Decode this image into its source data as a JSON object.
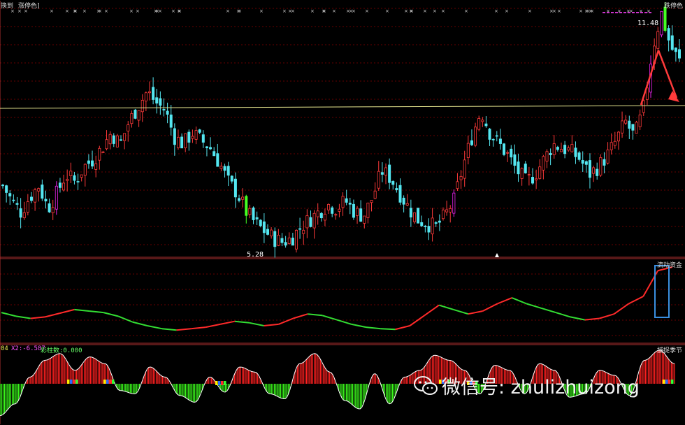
{
  "header": {
    "left_labels": [
      "换到",
      "涨停色]"
    ],
    "right_label": "跌停色"
  },
  "price_panel": {
    "high_label": "11.48",
    "low_label": "5.28"
  },
  "flow_panel": {
    "title": "流动资金"
  },
  "osc_panel": {
    "title": "捕捉季节",
    "indicator_prefix": "04",
    "x2_label": "X2:-6.587",
    "bar_label": "彩柱数:0.000"
  },
  "watermark": {
    "text": "微信号: zhulizhuizong"
  },
  "colors": {
    "up_candle": "#ff3a3a",
    "down_candle": "#54e6f0",
    "limit_up": "#ee22ee",
    "limit_down": "#44ff22",
    "horizontal_line": "#e8e890",
    "grid": "#8b0000",
    "arrow": "#ff3b3b",
    "box": "#3a8fe0"
  },
  "chart_data": [
    {
      "type": "candlestick",
      "title": "",
      "y_range": [
        5.0,
        11.6
      ],
      "annotations": [
        {
          "text": "11.48",
          "meaning": "period high"
        },
        {
          "text": "5.28",
          "meaning": "period low"
        }
      ],
      "close_path": [
        6.9,
        6.5,
        6.2,
        6.6,
        6.9,
        6.3,
        6.7,
        7.2,
        7.0,
        7.4,
        7.6,
        7.9,
        8.3,
        8.0,
        8.6,
        9.0,
        9.4,
        9.1,
        8.9,
        8.2,
        8.0,
        8.3,
        8.1,
        7.9,
        7.5,
        7.0,
        6.7,
        6.2,
        5.9,
        5.7,
        5.5,
        5.4,
        5.5,
        5.8,
        6.0,
        6.2,
        6.4,
        6.3,
        6.5,
        6.2,
        6.1,
        6.6,
        7.3,
        7.1,
        6.7,
        6.3,
        6.0,
        5.9,
        5.8,
        6.1,
        6.5,
        7.4,
        8.2,
        8.9,
        8.3,
        8.0,
        7.7,
        7.3,
        7.0,
        7.2,
        7.6,
        8.0,
        7.9,
        7.8,
        7.6,
        7.2,
        7.4,
        7.7,
        8.1,
        8.6,
        8.2,
        8.9,
        10.5,
        11.48,
        10.6,
        10.2
      ]
    },
    {
      "type": "line",
      "name": "流动资金",
      "values": [
        0.38,
        0.33,
        0.3,
        0.32,
        0.37,
        0.42,
        0.4,
        0.38,
        0.33,
        0.25,
        0.2,
        0.16,
        0.14,
        0.16,
        0.18,
        0.22,
        0.26,
        0.24,
        0.2,
        0.22,
        0.3,
        0.36,
        0.34,
        0.28,
        0.22,
        0.18,
        0.16,
        0.15,
        0.2,
        0.34,
        0.48,
        0.42,
        0.36,
        0.4,
        0.5,
        0.58,
        0.5,
        0.44,
        0.38,
        0.32,
        0.28,
        0.3,
        0.36,
        0.5,
        0.6,
        0.95,
        1.0
      ]
    },
    {
      "type": "area",
      "name": "捕捉季节",
      "values": [
        -0.95,
        -0.6,
        0.2,
        0.7,
        0.9,
        0.4,
        0.8,
        0.6,
        -0.2,
        -0.3,
        0.5,
        0.2,
        -0.35,
        -0.55,
        0.2,
        -0.25,
        0.5,
        0.35,
        -0.3,
        -0.45,
        0.6,
        0.9,
        0.35,
        -0.5,
        -0.75,
        0.3,
        -0.6,
        0.2,
        0.4,
        0.85,
        0.7,
        0.4,
        -0.3,
        0.55,
        0.4,
        -0.3,
        0.6,
        0.4,
        -0.4,
        -0.3,
        0.4,
        0.25,
        -0.35,
        0.7,
        1.0,
        0.6
      ]
    }
  ]
}
